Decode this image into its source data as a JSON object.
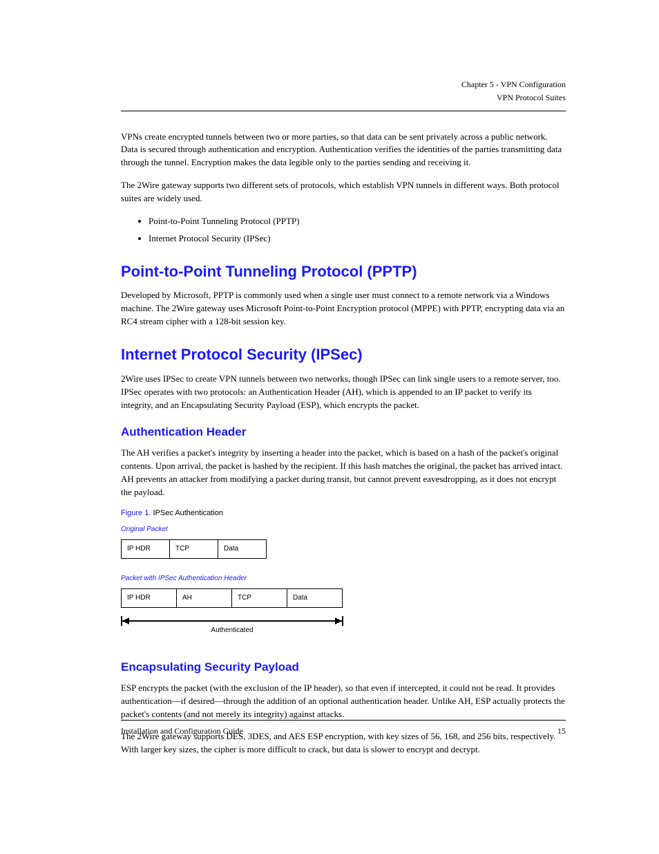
{
  "header": {
    "chapter": "Chapter 5 - VPN Configuration",
    "section": "VPN Protocol Suites"
  },
  "intro": {
    "p1": "VPNs create encrypted tunnels between two or more parties, so that data can be sent privately across a public network. Data is secured through authentication and encryption. Authentication verifies the identities of the parties transmitting data through the tunnel. Encryption makes the data legible only to the parties sending and receiving it.",
    "p2": "The 2Wire gateway supports two different sets of protocols, which establish VPN tunnels in different ways. Both protocol suites are widely used.",
    "li1": "Point-to-Point Tunneling Protocol (PPTP)",
    "li2": "Internet Protocol Security (IPSec)"
  },
  "pptp": {
    "heading": "Point-to-Point Tunneling Protocol (PPTP)",
    "p1": "Developed by Microsoft, PPTP is commonly used when a single user must connect to a remote network via a Windows machine. The 2Wire gateway uses Microsoft Point-to-Point Encryption protocol (MPPE) with PPTP, encrypting data via an RC4 stream cipher with a 128-bit session key."
  },
  "ipsec": {
    "heading": "Internet Protocol Security (IPSec)",
    "p1": "2Wire uses IPSec to create VPN tunnels between two networks, though IPSec can link single users to a remote server, too. IPSec operates with two protocols: an Authentication Header (AH), which is appended to an IP packet to verify its integrity, and an Encapsulating Security Payload (ESP), which encrypts the packet.",
    "ah_heading": "Authentication Header",
    "p2": "The AH verifies a packet's integrity by inserting a header into the packet, which is based on a hash of the packet's original contents. Upon arrival, the packet is hashed by the recipient. If this hash matches the original, the packet has arrived intact. AH prevents an attacker from modifying a packet during transit, but cannot prevent eavesdropping, as it does not encrypt the payload.",
    "fig1_no": "Figure 1.",
    "fig1_title": "IPSec Authentication",
    "orig_label": "Original Packet",
    "orig_cells": [
      "IP HDR",
      "TCP",
      "Data"
    ],
    "auth_label": "Packet with IPSec Authentication Header",
    "auth_cells": [
      "IP HDR",
      "AH",
      "TCP",
      "Data"
    ],
    "arrow_label": "Authenticated",
    "esp_heading": "Encapsulating Security Payload",
    "p3": "ESP encrypts the packet (with the exclusion of the IP header), so that even if intercepted, it could not be read. It provides authentication—if desired—through the addition of an optional authentication header. Unlike AH, ESP actually protects the packet's contents (and not merely its integrity) against attacks.",
    "p4": "The 2Wire gateway supports DES, 3DES, and AES ESP encryption, with key sizes of 56, 168, and 256 bits, respectively. With larger key sizes, the cipher is more difficult to crack, but data is slower to encrypt and decrypt."
  },
  "footer": {
    "left": "Installation and Configuration Guide",
    "right": "15"
  }
}
